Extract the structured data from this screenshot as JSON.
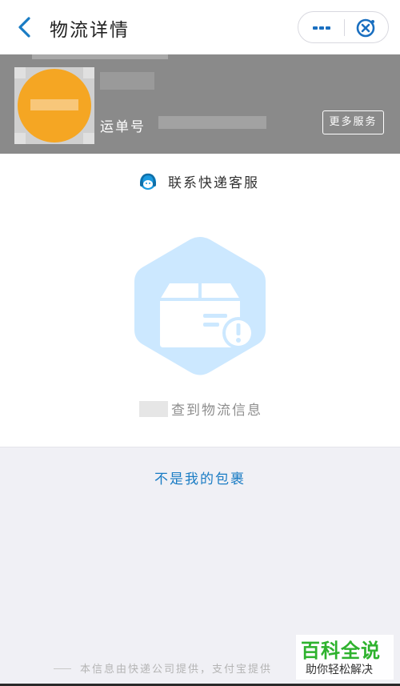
{
  "header": {
    "title": "物流详情",
    "back_icon": "chevron-left-icon",
    "more_icon": "more-dots-icon",
    "close_icon": "close-target-icon",
    "accent_color": "#1a7cc4"
  },
  "info": {
    "waybill_label": "运单号",
    "more_services_label": "更多服务",
    "band_color": "#8a8a8a",
    "logo_color": "#f5a623"
  },
  "card": {
    "contact_label": "联系快递客服",
    "empty_message": "查到物流信息",
    "illustration_icon": "package-alert-icon",
    "illustration_color": "#cce8ff"
  },
  "not_mine_label": "不是我的包裹",
  "footer": {
    "source_text": "本信息由快递公司提供，支付宝提供"
  },
  "watermark": {
    "title": "百科全说",
    "subtitle": "助你轻松解决",
    "color": "#2db22d"
  }
}
